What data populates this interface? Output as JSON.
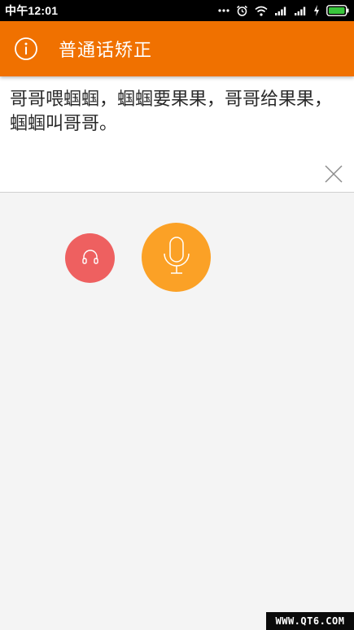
{
  "status_bar": {
    "time": "中午12:01",
    "icons": [
      "more-dots-icon",
      "alarm-icon",
      "wifi-icon",
      "signal-icon",
      "signal-icon",
      "charging-icon",
      "battery-icon"
    ]
  },
  "toolbar": {
    "title": "普通话矫正",
    "icon": "info-icon"
  },
  "text_panel": {
    "text": "哥哥喂蝈蝈，蝈蝈要果果，哥哥给果果，蝈蝈叫哥哥。",
    "clear_icon": "close-icon"
  },
  "controls": {
    "listen_icon": "headphones-icon",
    "record_icon": "microphone-icon"
  },
  "watermark": {
    "text": "WWW.QT6.COM"
  },
  "colors": {
    "toolbar": "#f07100",
    "listen_button": "#ee6060",
    "record_button": "#fba126",
    "background": "#f4f4f4"
  }
}
